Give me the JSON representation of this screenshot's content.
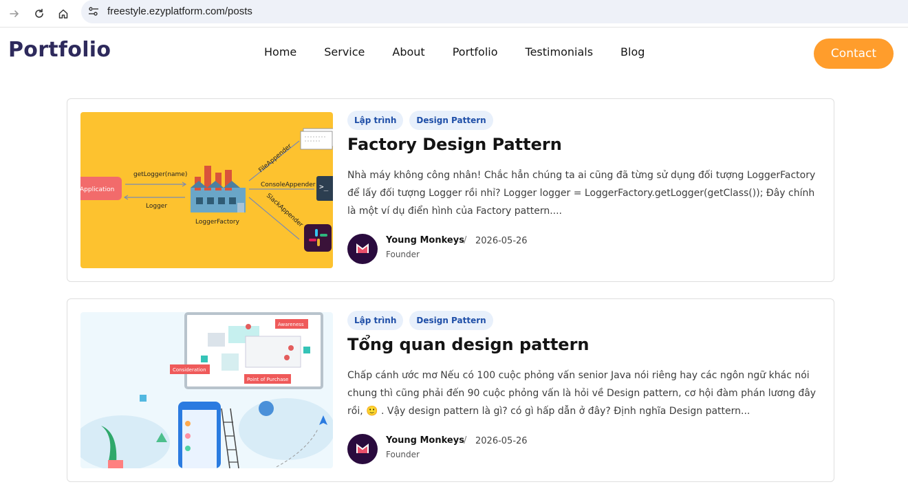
{
  "browser": {
    "url": "freestyle.ezyplatform.com/posts",
    "icons": [
      "forward-arrow-icon",
      "reload-icon",
      "home-icon",
      "site-info-icon"
    ]
  },
  "header": {
    "logo": "Portfolio",
    "nav": [
      "Home",
      "Service",
      "About",
      "Portfolio",
      "Testimonials",
      "Blog"
    ],
    "contact_label": "Contact",
    "colors": {
      "logo": "#2e2a5c",
      "contact_bg": "#ff9d2c"
    }
  },
  "posts": [
    {
      "tags": [
        "Lập trình",
        "Design Pattern"
      ],
      "title": "Factory Design Pattern",
      "excerpt": "Nhà máy không công nhân! Chắc hẳn chúng ta ai cũng đã từng sử dụng đối tượng LoggerFactory để lấy đối tượng Logger rồi nhỉ? Logger logger = LoggerFactory.getLogger(getClass()); Đây chính là một ví dụ điển hình của Factory pattern....",
      "author": "Young Monkeys",
      "date": "2026-05-26",
      "role": "Founder",
      "image": {
        "application": "Application",
        "get_logger": "getLogger(name)",
        "logger": "Logger",
        "logger_factory": "LoggerFactory",
        "file_appender": "FileAppender",
        "console_appender": "ConsoleAppender",
        "slack_appender": "SlackAppender",
        "bg": "#fdc22f"
      }
    },
    {
      "tags": [
        "Lập trình",
        "Design Pattern"
      ],
      "title": "Tổng quan design pattern",
      "excerpt": "Chấp cánh ước mơ Nếu có 100 cuộc phỏng vấn senior Java nói riêng hay các ngôn ngữ khác nói chung thì cũng phải đến 90 cuộc phỏng vấn là hỏi về Design pattern, cơ hội đàm phán lương đây rồi, 🙂 . Vậy design pattern là gì? có gì hấp dẫn ở đây? Định nghĩa Design pattern...",
      "author": "Young Monkeys",
      "date": "2026-05-26",
      "role": "Founder",
      "image": {
        "awareness": "Awareness",
        "consideration": "Consideration",
        "point_of_purchase": "Point of Purchase",
        "bg": "#eef8fd"
      }
    }
  ]
}
